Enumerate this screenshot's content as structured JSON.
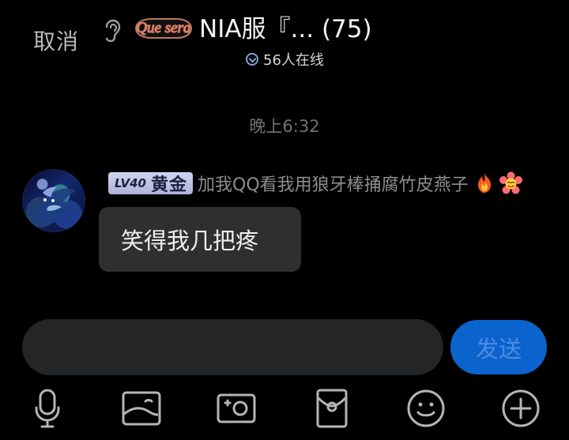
{
  "header": {
    "cancel_label": "取消",
    "brand_text": "Que sera",
    "group_title": "NIA服『... (75)",
    "online_text": "56人在线"
  },
  "chat": {
    "timestamp": "晚上6:32",
    "message": {
      "level_badge": "LV40",
      "title": "黄金",
      "sender_name": "加我QQ看我用狼牙棒捅腐竹皮燕子",
      "body": "笑得我几把疼"
    }
  },
  "composer": {
    "send_label": "发送"
  },
  "icons": {
    "voice": "microphone-icon",
    "image": "image-icon",
    "camera": "camera-icon",
    "red_packet": "red-packet-icon",
    "emoji": "emoji-icon",
    "more": "plus-icon"
  },
  "colors": {
    "background": "#000000",
    "bubble": "#2d302f",
    "composer": "#232526",
    "send": "#0b64ce",
    "timestamp": "#727272",
    "sender": "#8d8d8d",
    "level_badge": "#c7cceb"
  }
}
